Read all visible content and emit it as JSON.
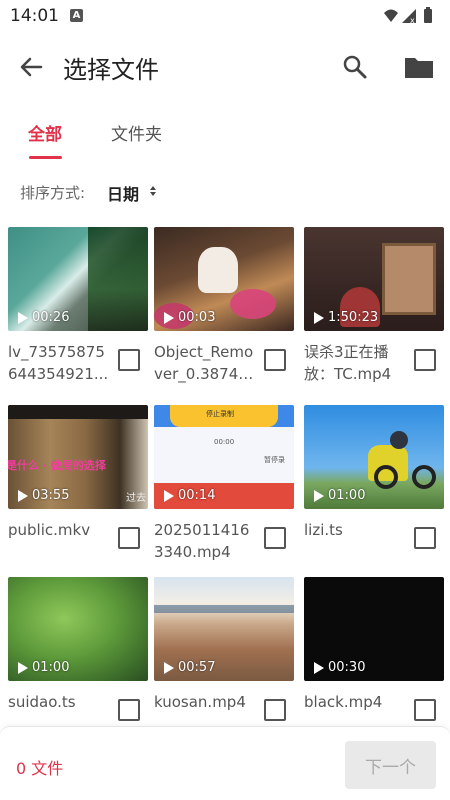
{
  "status_bar": {
    "time": "14:01",
    "notification_icon": "A"
  },
  "app_bar": {
    "title": "选择文件"
  },
  "tabs": [
    {
      "label": "全部",
      "active": true
    },
    {
      "label": "文件夹",
      "active": false
    }
  ],
  "sort": {
    "label": "排序方式:",
    "value": "日期"
  },
  "files": [
    {
      "name_line1": "lv_73575875",
      "name_line2": "644354921...",
      "duration": "00:26",
      "checked": false
    },
    {
      "name_line1": "Object_Remo",
      "name_line2": "ver_0.38741...",
      "duration": "00:03",
      "checked": false
    },
    {
      "name_line1": "误杀3正在播",
      "name_line2": "放：TC.mp4",
      "duration": "1:50:23",
      "checked": false
    },
    {
      "name_line1": "public.mkv",
      "name_line2": "",
      "duration": "03:55",
      "checked": false
    },
    {
      "name_line1": "2025011416",
      "name_line2": "3340.mp4",
      "duration": "00:14",
      "checked": false
    },
    {
      "name_line1": "lizi.ts",
      "name_line2": "",
      "duration": "01:00",
      "checked": false
    },
    {
      "name_line1": "suidao.ts",
      "name_line2": "",
      "duration": "01:00",
      "checked": false
    },
    {
      "name_line1": "kuosan.mp4",
      "name_line2": "",
      "duration": "00:57",
      "checked": false
    },
    {
      "name_line1": "black.mp4",
      "name_line2": "",
      "duration": "00:30",
      "checked": false
    }
  ],
  "thumb_overlays": {
    "public_caption": "是什么 · 做局的选择",
    "public_caption2": "过去",
    "app_text_1": "停止录制",
    "app_text_2": "00:00",
    "app_text_3": "暂停录"
  },
  "bottom_bar": {
    "count_label": "0 文件",
    "next_label": "下一个"
  },
  "colors": {
    "accent": "#e0334b",
    "disabled_button": "#e9e9e9"
  }
}
